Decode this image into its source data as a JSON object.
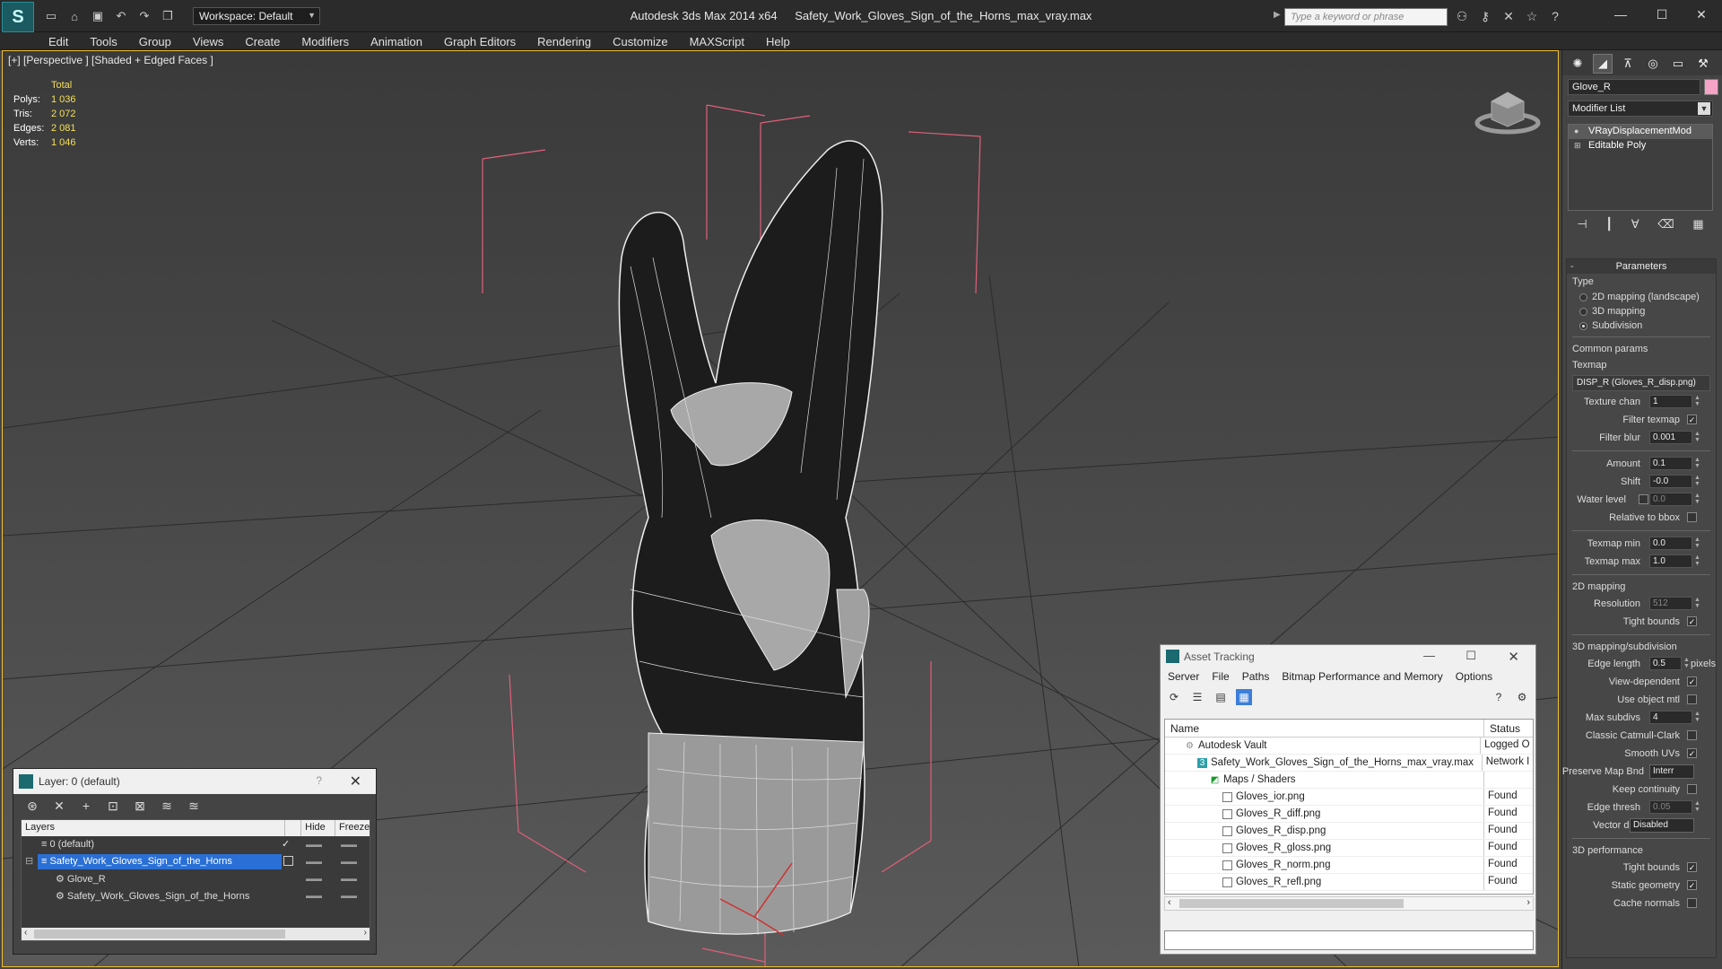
{
  "app": {
    "logo": "S",
    "title": "Autodesk 3ds Max  2014 x64",
    "file": "Safety_Work_Gloves_Sign_of_the_Horns_max_vray.max",
    "workspace": "Workspace: Default",
    "search_placeholder": "Type a keyword or phrase",
    "minimize": "—",
    "maximize": "☐",
    "close": "✕"
  },
  "menu": [
    "Edit",
    "Tools",
    "Group",
    "Views",
    "Create",
    "Modifiers",
    "Animation",
    "Graph Editors",
    "Rendering",
    "Customize",
    "MAXScript",
    "Help"
  ],
  "viewport": {
    "label": "[+] [Perspective ] [Shaded + Edged Faces ]",
    "stats_header": "Total",
    "stats": [
      {
        "k": "Polys:",
        "v": "1 036"
      },
      {
        "k": "Tris:",
        "v": "2 072"
      },
      {
        "k": "Edges:",
        "v": "2 081"
      },
      {
        "k": "Verts:",
        "v": "1 046"
      }
    ]
  },
  "command_panel": {
    "object_name": "Glove_R",
    "object_color": "#f5a3c6",
    "modifier_list": "Modifier List",
    "stack": [
      {
        "label": "VRayDisplacementMod",
        "icon": "bulb-icon"
      },
      {
        "label": "Editable Poly",
        "icon": "plus-icon"
      }
    ],
    "parameters_title": "Parameters",
    "type_group": "Type",
    "type_options": [
      "2D mapping (landscape)",
      "3D mapping",
      "Subdivision"
    ],
    "selected_type": "Subdivision",
    "common_params": "Common params",
    "texmap_label": "Texmap",
    "texmap_value": "DISP_R (Gloves_R_disp.png)",
    "texture_chan_label": "Texture chan",
    "texture_chan": "1",
    "filter_texmap": "Filter texmap",
    "filter_blur_label": "Filter blur",
    "filter_blur": "0.001",
    "amount_label": "Amount",
    "amount": "0.1",
    "shift_label": "Shift",
    "shift": "-0.0",
    "water_level_label": "Water level",
    "water_level": "0.0",
    "relative_bbox": "Relative to bbox",
    "texmap_min_label": "Texmap min",
    "texmap_min": "0.0",
    "texmap_max_label": "Texmap max",
    "texmap_max": "1.0",
    "mapping_2d": "2D mapping",
    "resolution_label": "Resolution",
    "resolution": "512",
    "tight_bounds": "Tight bounds",
    "mapping_3d": "3D mapping/subdivision",
    "edge_length_label": "Edge length",
    "edge_length": "0.5",
    "pixels": "pixels",
    "view_dependent": "View-dependent",
    "use_object_mtl": "Use object mtl",
    "max_subdivs_label": "Max subdivs",
    "max_subdivs": "4",
    "classic_catmull": "Classic Catmull-Clark",
    "smooth_uvs": "Smooth UVs",
    "preserve_map_label": "Preserve Map Bnd",
    "preserve_map": "Interr",
    "keep_continuity": "Keep continuity",
    "edge_thresh_label": "Edge thresh",
    "edge_thresh": "0.05",
    "vector_displ_label": "Vector displ",
    "vector_displ": "Disabled",
    "perf_group": "3D performance",
    "tight_bounds_2": "Tight bounds",
    "static_geometry": "Static geometry",
    "cache_normals": "Cache normals"
  },
  "layer_window": {
    "title": "Layer: 0 (default)",
    "help": "?",
    "close": "✕",
    "col_layers": "Layers",
    "col_hide": "Hide",
    "col_freeze": "Freeze",
    "rows": [
      {
        "name": "0 (default)",
        "indent": 18
      },
      {
        "name": "Safety_Work_Gloves_Sign_of_the_Horns",
        "indent": 18
      },
      {
        "name": "Glove_R",
        "indent": 34
      },
      {
        "name": "Safety_Work_Gloves_Sign_of_the_Horns",
        "indent": 34
      }
    ]
  },
  "asset_window": {
    "title": "Asset Tracking",
    "menu": [
      "Server",
      "File",
      "Paths",
      "Bitmap Performance and Memory",
      "Options"
    ],
    "col_name": "Name",
    "col_status": "Status",
    "rows": [
      {
        "name": "Autodesk Vault",
        "status": "Logged O",
        "indent": 22,
        "icon": "vault-icon"
      },
      {
        "name": "Safety_Work_Gloves_Sign_of_the_Horns_max_vray.max",
        "status": "Network I",
        "indent": 36,
        "icon": "max-file-icon"
      },
      {
        "name": "Maps / Shaders",
        "status": "",
        "indent": 50,
        "icon": "maps-icon"
      },
      {
        "name": "Gloves_ior.png",
        "status": "Found",
        "indent": 64,
        "icon": "image-file-icon"
      },
      {
        "name": "Gloves_R_diff.png",
        "status": "Found",
        "indent": 64,
        "icon": "image-file-icon"
      },
      {
        "name": "Gloves_R_disp.png",
        "status": "Found",
        "indent": 64,
        "icon": "image-file-icon"
      },
      {
        "name": "Gloves_R_gloss.png",
        "status": "Found",
        "indent": 64,
        "icon": "image-file-icon"
      },
      {
        "name": "Gloves_R_norm.png",
        "status": "Found",
        "indent": 64,
        "icon": "image-file-icon"
      },
      {
        "name": "Gloves_R_refl.png",
        "status": "Found",
        "indent": 64,
        "icon": "image-file-icon"
      }
    ]
  },
  "colors": {
    "accent_blue": "#2a6fd6",
    "viewport_border": "#f2c230",
    "stat_value": "#f5e05a",
    "bbox_pink": "#e0607a"
  }
}
